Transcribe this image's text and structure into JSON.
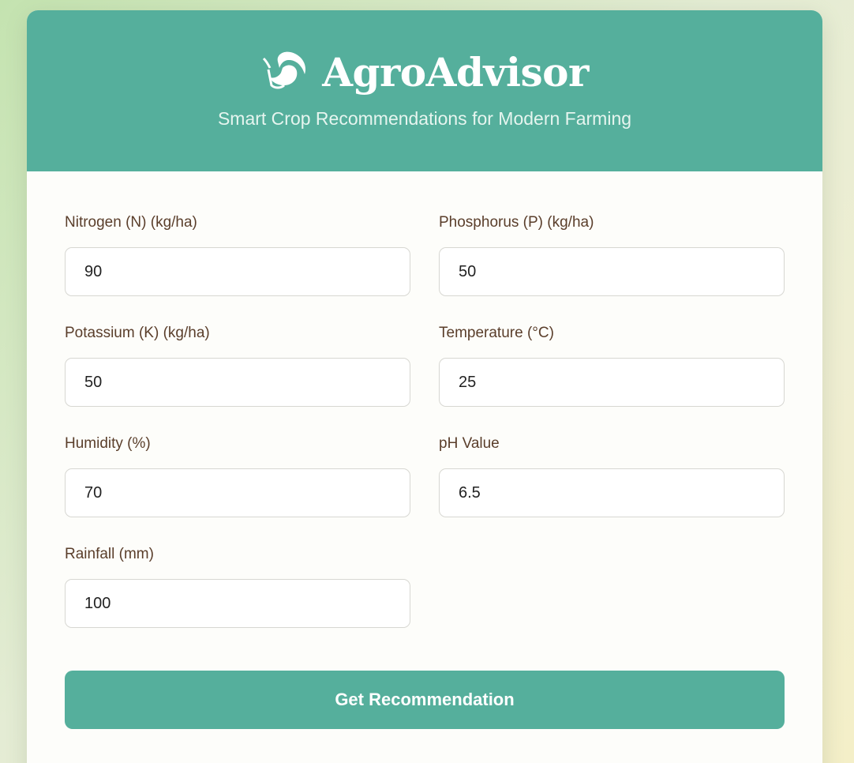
{
  "header": {
    "title": "AgroAdvisor",
    "subtitle": "Smart Crop Recommendations for Modern Farming",
    "icon": "seedling-icon"
  },
  "form": {
    "fields": [
      {
        "label": "Nitrogen (N) (kg/ha)",
        "value": "90"
      },
      {
        "label": "Phosphorus (P) (kg/ha)",
        "value": "50"
      },
      {
        "label": "Potassium (K) (kg/ha)",
        "value": "50"
      },
      {
        "label": "Temperature (°C)",
        "value": "25"
      },
      {
        "label": "Humidity (%)",
        "value": "70"
      },
      {
        "label": "pH Value",
        "value": "6.5"
      },
      {
        "label": "Rainfall (mm)",
        "value": "100"
      }
    ],
    "submit_label": "Get Recommendation"
  },
  "colors": {
    "primary": "#55af9c",
    "label_text": "#5a3e2b",
    "card_bg": "#fdfdfa"
  }
}
